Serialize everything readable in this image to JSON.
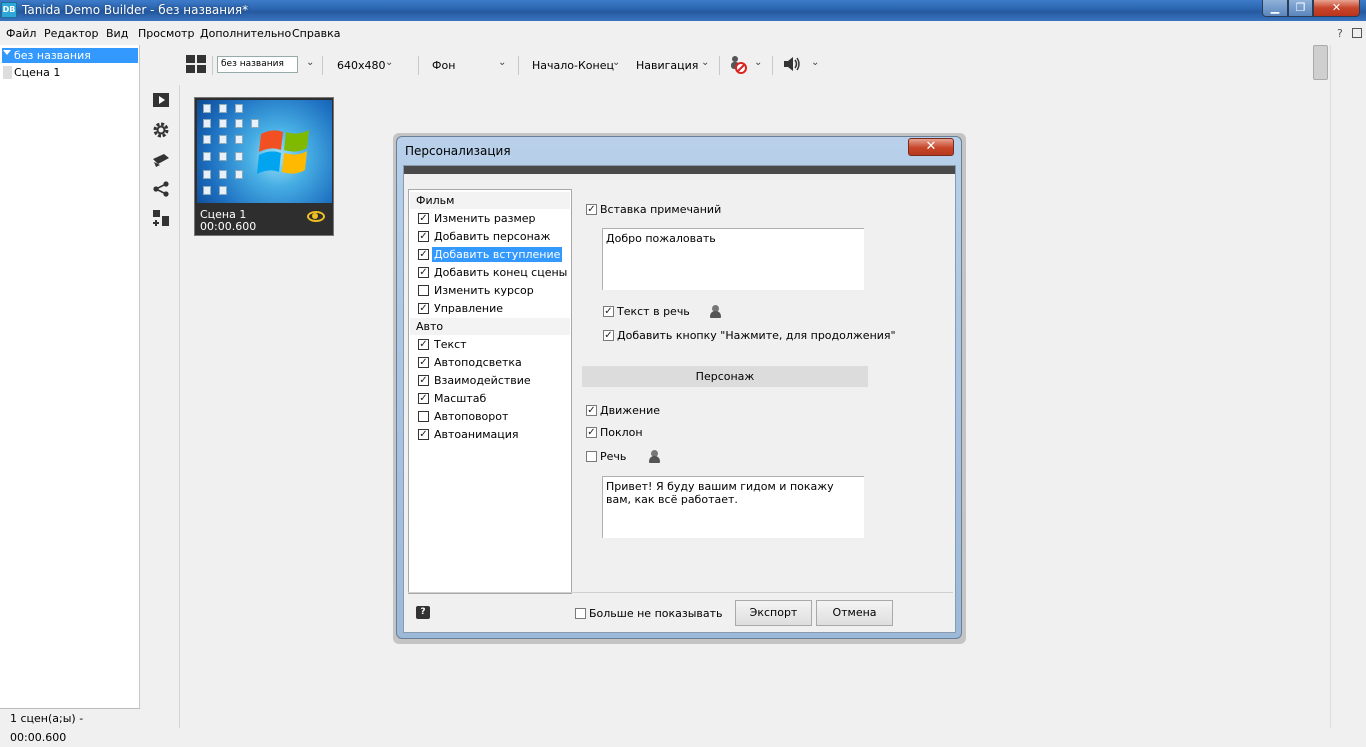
{
  "window": {
    "app_logo": "DB",
    "title": "Tanida Demo Builder - без названия*",
    "min_glyph": "▁",
    "max_glyph": "❐",
    "close_glyph": "✕"
  },
  "menu": {
    "items": [
      "Файл",
      "Редактор",
      "Вид",
      "Просмотр",
      "Дополнительно",
      "Справка"
    ],
    "help_glyph": "?"
  },
  "toolbar": {
    "project_name": "без названия",
    "resolution": "640x480",
    "background": "Фон",
    "start_end": "Начало-Конец",
    "navigation": "Навигация",
    "chevron": "⌄"
  },
  "tree": {
    "root": "без названия",
    "scene": "Сцена 1"
  },
  "status": {
    "summary": "1 сцен(а;ы) - 00:00.600"
  },
  "scene_thumb": {
    "label": "Сцена 1",
    "time": "00:00.600"
  },
  "dialog": {
    "title": "Персонализация",
    "close_glyph": "✕",
    "groups": [
      {
        "header": "Фильм",
        "items": [
          {
            "label": "Изменить размер",
            "checked": true
          },
          {
            "label": "Добавить персонаж",
            "checked": true
          },
          {
            "label": "Добавить вступление",
            "checked": true,
            "selected": true
          },
          {
            "label": "Добавить конец сцены",
            "checked": true
          },
          {
            "label": "Изменить курсор",
            "checked": false
          },
          {
            "label": "Управление",
            "checked": true
          }
        ]
      },
      {
        "header": "Авто",
        "items": [
          {
            "label": "Текст",
            "checked": true
          },
          {
            "label": "Автоподсветка",
            "checked": true
          },
          {
            "label": "Взаимодействие",
            "checked": true
          },
          {
            "label": "Масштаб",
            "checked": true
          },
          {
            "label": "Автоповорот",
            "checked": false
          },
          {
            "label": "Автоанимация",
            "checked": true
          }
        ]
      }
    ],
    "notes_label": "Вставка примечаний",
    "notes_text": "Добро пожаловать",
    "tts_label": "Текст в речь",
    "continue_btn_label": "Добавить кнопку \"Нажмите, для продолжения\"",
    "character_section": "Персонаж",
    "movement_label": "Движение",
    "bow_label": "Поклон",
    "speech_label": "Речь",
    "speech_text": "Привет! Я буду вашим гидом и покажу вам, как всё работает.",
    "dont_show_label": "Больше не показывать",
    "help_glyph": "?",
    "export_label": "Экспорт",
    "cancel_label": "Отмена",
    "check_glyph": "✓"
  }
}
